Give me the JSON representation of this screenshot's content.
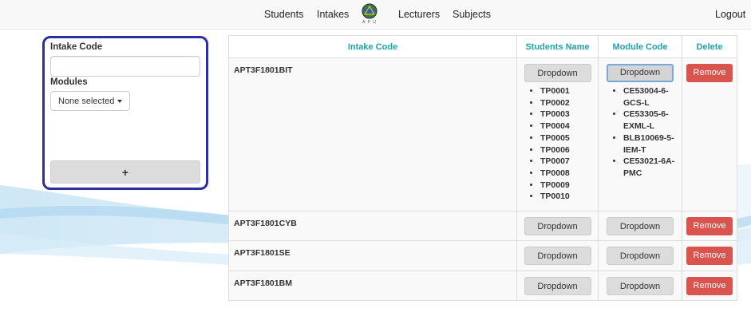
{
  "nav": {
    "students": "Students",
    "intakes": "Intakes",
    "logo_text": "A P U",
    "lecturers": "Lecturers",
    "subjects": "Subjects",
    "logout": "Logout"
  },
  "form": {
    "intake_code_label": "Intake Code",
    "intake_code_value": "",
    "modules_label": "Modules",
    "modules_selected": "None selected",
    "add_label": "+"
  },
  "table": {
    "headers": {
      "intake_code": "Intake Code",
      "students_name": "Students Name",
      "module_code": "Module Code",
      "delete": "Delete"
    },
    "dropdown_label": "Dropdown",
    "remove_label": "Remove",
    "rows": [
      {
        "code": "APT3F1801BIT",
        "students": [
          "TP0001",
          "TP0002",
          "TP0003",
          "TP0004",
          "TP0005",
          "TP0006",
          "TP0007",
          "TP0008",
          "TP0009",
          "TP0010"
        ],
        "modules": [
          "CE53004-6-GCS-L",
          "CE53305-6-EXML-L",
          "BLB10069-5-IEM-T",
          "CE53021-6A-PMC"
        ]
      },
      {
        "code": "APT3F1801CYB"
      },
      {
        "code": "APT3F1801SE"
      },
      {
        "code": "APT3F1801BM"
      }
    ]
  },
  "colors": {
    "header_accent": "#1fa3a9",
    "remove_button": "#d9534f",
    "panel_border": "#2b2fa3"
  }
}
